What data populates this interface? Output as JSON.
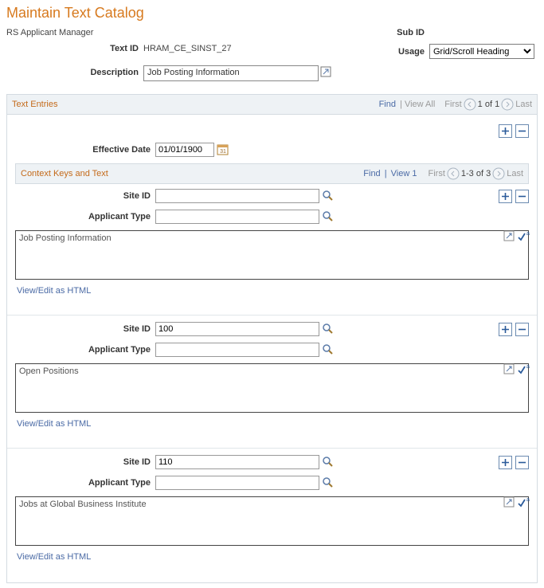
{
  "title": "Maintain Text Catalog",
  "header": {
    "left_label": "RS Applicant Manager",
    "sub_id_label": "Sub ID",
    "text_id_label": "Text ID",
    "text_id_value": "HRAM_CE_SINST_27",
    "usage_label": "Usage",
    "usage_value": "Grid/Scroll Heading",
    "description_label": "Description",
    "description_value": "Job Posting Information"
  },
  "text_entries": {
    "title": "Text Entries",
    "find": "Find",
    "view_all": "View All",
    "first": "First",
    "page": "1 of 1",
    "last": "Last",
    "eff_date_label": "Effective Date",
    "eff_date_value": "01/01/1900"
  },
  "context": {
    "title": "Context Keys and Text",
    "find": "Find",
    "view1": "View 1",
    "first": "First",
    "page": "1-3 of 3",
    "last": "Last",
    "site_id_label": "Site ID",
    "applicant_type_label": "Applicant Type",
    "view_edit_html": "View/Edit as HTML",
    "rows": [
      {
        "site_id": "",
        "applicant_type": "",
        "text": "Job Posting Information"
      },
      {
        "site_id": "100",
        "applicant_type": "",
        "text": "Open Positions"
      },
      {
        "site_id": "110",
        "applicant_type": "",
        "text": "Jobs at Global Business Institute"
      }
    ]
  }
}
